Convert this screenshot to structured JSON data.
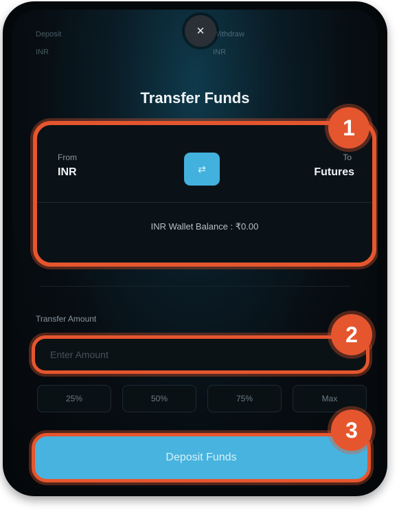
{
  "background_header": {
    "left_label": "Deposit",
    "left_value": "INR",
    "right_label": "Withdraw",
    "right_value": "INR"
  },
  "modal": {
    "close_symbol": "✕",
    "title": "Transfer Funds",
    "from_label": "From",
    "from_value": "INR",
    "to_label": "To",
    "to_value": "Futures",
    "swap_symbol": "⇄",
    "balance_text": "INR Wallet Balance : ₹0.00",
    "amount_label": "Transfer Amount",
    "amount_placeholder": "Enter Amount",
    "percent_options": [
      "25%",
      "50%",
      "75%",
      "Max"
    ],
    "deposit_label": "Deposit Funds"
  },
  "annotations": [
    "1",
    "2",
    "3"
  ],
  "colors": {
    "accent": "#47b3de",
    "highlight": "#e5562e",
    "background": "#05080b"
  }
}
